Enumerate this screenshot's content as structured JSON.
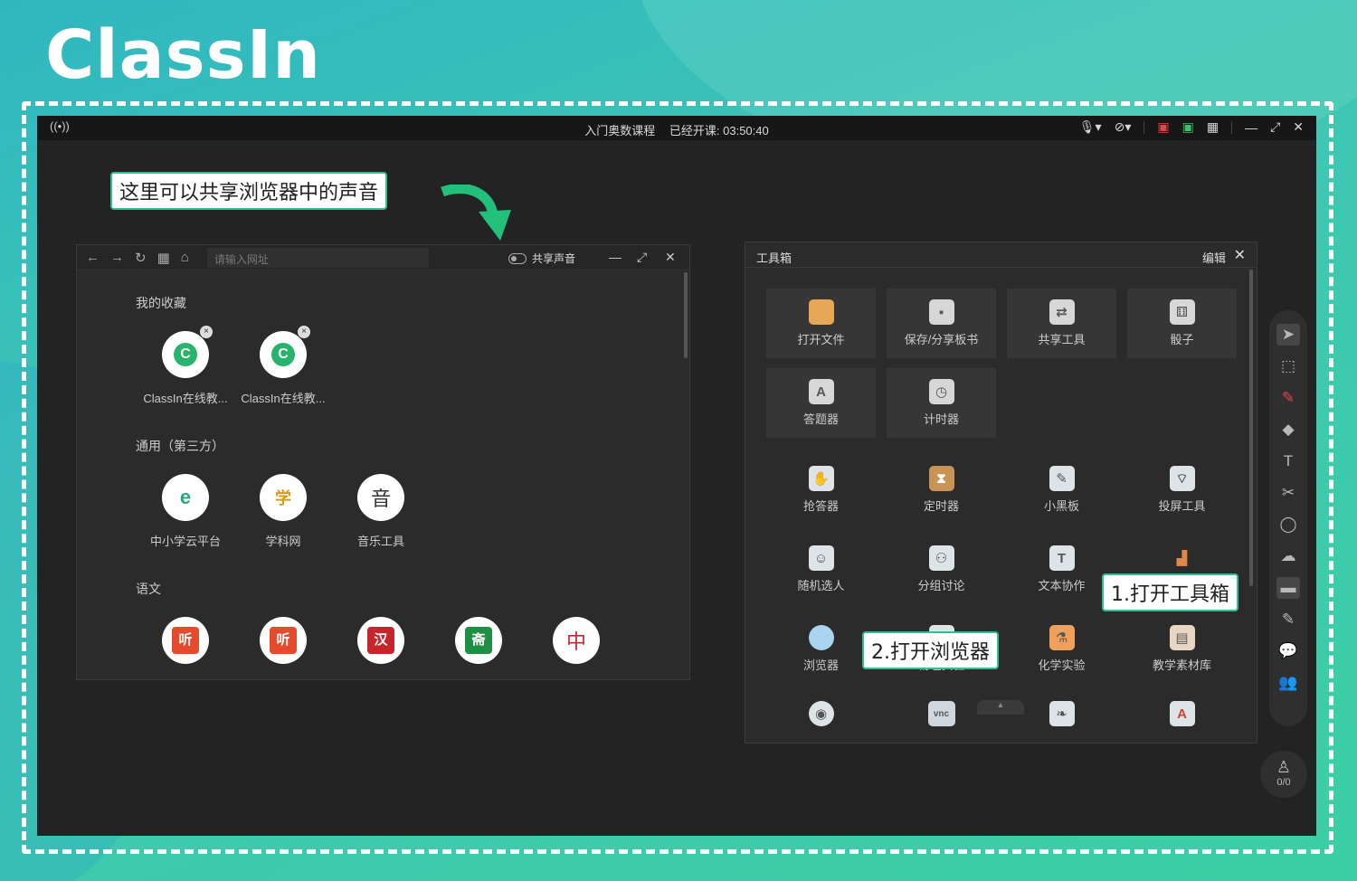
{
  "brand": {
    "logo_text": "ClassIn"
  },
  "titlebar": {
    "course_name": "入门奥数课程",
    "class_time_label": "已经开课: 03:50:40",
    "broadcast_icon": "((•))",
    "icons": [
      "mic-muted-icon",
      "camera-muted-icon",
      "record-icon",
      "video-icon",
      "grid-icon",
      "minimize-icon",
      "expand-icon",
      "close-icon"
    ]
  },
  "callouts": {
    "share_sound_tip": "这里可以共享浏览器中的声音",
    "open_toolbox": "1.打开工具箱",
    "open_browser": "2.打开浏览器"
  },
  "browser": {
    "url_placeholder": "请输入网址",
    "share_sound_label": "共享声音",
    "sections": {
      "favorites": "我的收藏",
      "general": "通用（第三方）",
      "chinese": "语文"
    },
    "favorites": [
      {
        "label": "ClassIn在线教...",
        "glyph": "C"
      },
      {
        "label": "ClassIn在线教...",
        "glyph": "C"
      }
    ],
    "general_apps": [
      {
        "label": "中小学云平台",
        "glyph": "e"
      },
      {
        "label": "学科网",
        "glyph": "学"
      },
      {
        "label": "音乐工具",
        "glyph": "音"
      }
    ],
    "chinese_apps": [
      {
        "glyph": "听"
      },
      {
        "glyph": "听"
      },
      {
        "glyph": "汉"
      },
      {
        "glyph": "斋"
      },
      {
        "glyph": "中"
      }
    ]
  },
  "toolbox": {
    "title": "工具箱",
    "edit_label": "编辑",
    "close_glyph": "✕",
    "cards": [
      {
        "label": "打开文件",
        "icon": "folder-icon"
      },
      {
        "label": "保存/分享板书",
        "icon": "save-icon"
      },
      {
        "label": "共享工具",
        "icon": "share-screen-icon"
      },
      {
        "label": "骰子",
        "icon": "dice-icon"
      },
      {
        "label": "答题器",
        "icon": "answer-icon"
      },
      {
        "label": "计时器",
        "icon": "stopwatch-icon"
      }
    ],
    "tools": [
      {
        "label": "抢答器",
        "icon": "hand-icon"
      },
      {
        "label": "定时器",
        "icon": "hourglass-icon"
      },
      {
        "label": "小黑板",
        "icon": "blackboard-icon"
      },
      {
        "label": "投屏工具",
        "icon": "cast-icon"
      },
      {
        "label": "随机选人",
        "icon": "random-pick-icon"
      },
      {
        "label": "分组讨论",
        "icon": "group-icon"
      },
      {
        "label": "文本协作",
        "icon": "text-collab-icon"
      },
      {
        "label": "",
        "icon": "chart-icon"
      },
      {
        "label": "浏览器",
        "icon": "globe-icon"
      },
      {
        "label": "物理实验",
        "icon": "physics-icon"
      },
      {
        "label": "化学实验",
        "icon": "flask-icon"
      },
      {
        "label": "教学素材库",
        "icon": "library-icon"
      },
      {
        "label": "",
        "icon": "webcam-icon"
      },
      {
        "label": "",
        "icon": "vnc-icon"
      },
      {
        "label": "",
        "icon": "classin-book-icon"
      },
      {
        "label": "",
        "icon": "grade-icon"
      }
    ],
    "vnc_text": "vnc"
  },
  "seat": {
    "count": "0/0"
  }
}
